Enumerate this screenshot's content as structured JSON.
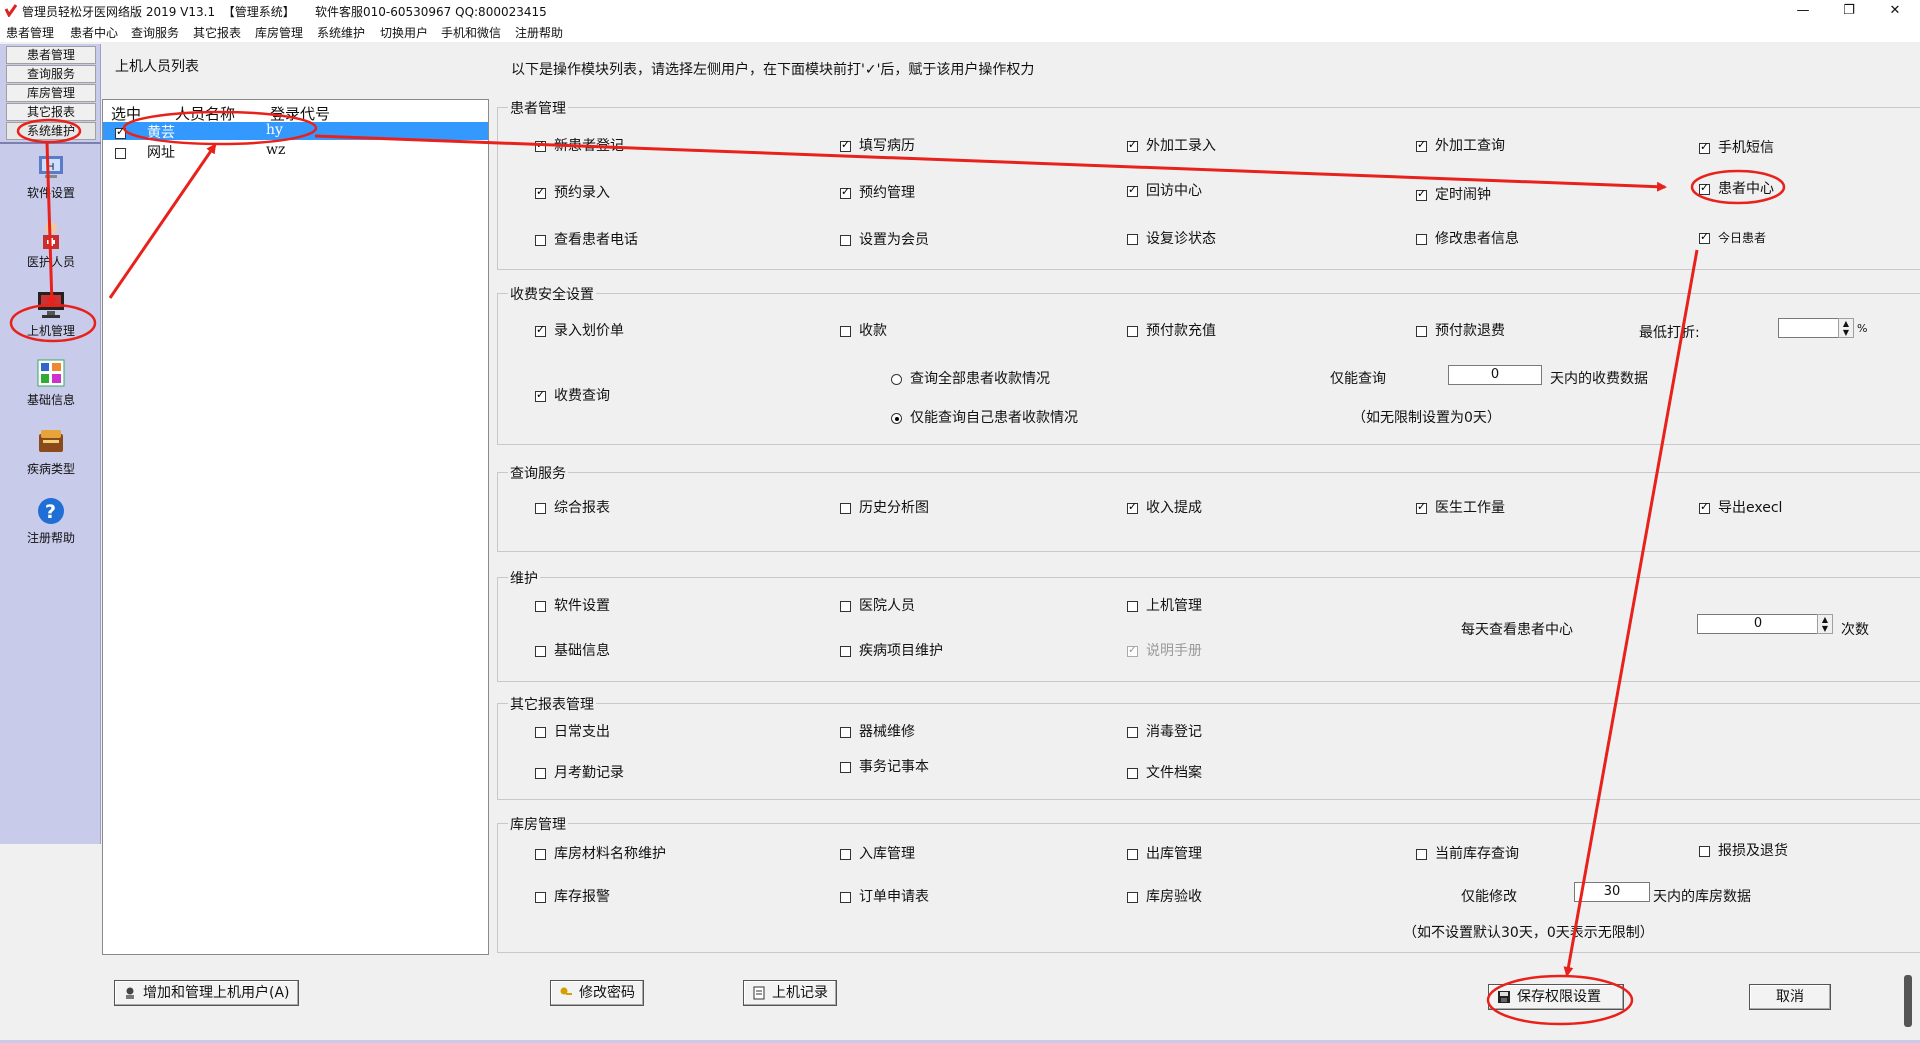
{
  "window": {
    "title": "管理员轻松牙医网络版 2019 V13.1",
    "system_tag": "【管理系统】",
    "support": "软件客服010-60530967 QQ:800023415",
    "controls": {
      "minimize": "—",
      "restore": "❐",
      "close": "✕"
    }
  },
  "menubar": [
    "患者管理",
    "患者中心",
    "查询服务",
    "其它报表",
    "库房管理",
    "系统维护",
    "切换用户",
    "手机和微信",
    "注册帮助"
  ],
  "leftnav": {
    "tabs": [
      "患者管理",
      "查询服务",
      "库房管理",
      "其它报表",
      "系统维护"
    ],
    "buttons": [
      {
        "label": "软件设置",
        "icon": "software-settings-icon"
      },
      {
        "label": "医护人员",
        "icon": "medical-staff-icon"
      },
      {
        "label": "上机管理",
        "icon": "computer-management-icon"
      },
      {
        "label": "基础信息",
        "icon": "basic-info-icon"
      },
      {
        "label": "疾病类型",
        "icon": "disease-type-icon"
      },
      {
        "label": "注册帮助",
        "icon": "help-icon"
      }
    ]
  },
  "userpanel": {
    "title": "上机人员列表",
    "headers": {
      "select": "选中",
      "name": "人员名称",
      "code": "登录代号"
    },
    "rows": [
      {
        "checked": true,
        "name": "黄芸",
        "code": "hy",
        "selected": true
      },
      {
        "checked": false,
        "name": "网址",
        "code": "wz",
        "selected": false
      }
    ]
  },
  "hint": "以下是操作模块列表，请选择左侧用户，在下面模块前打'✓'后，赋于该用户操作权力",
  "groups": {
    "patient": {
      "title": "患者管理",
      "items": [
        {
          "label": "新患者登记",
          "checked": true
        },
        {
          "label": "填写病历",
          "checked": true
        },
        {
          "label": "外加工录入",
          "checked": true
        },
        {
          "label": "外加工查询",
          "checked": true
        },
        {
          "label": "手机短信",
          "checked": true
        },
        {
          "label": "预约录入",
          "checked": true
        },
        {
          "label": "预约管理",
          "checked": true
        },
        {
          "label": "回访中心",
          "checked": true
        },
        {
          "label": "定时闹钟",
          "checked": true
        },
        {
          "label": "患者中心",
          "checked": true
        },
        {
          "label": "查看患者电话",
          "checked": false
        },
        {
          "label": "设置为会员",
          "checked": false
        },
        {
          "label": "设复诊状态",
          "checked": false
        },
        {
          "label": "修改患者信息",
          "checked": false
        },
        {
          "label": "今日患者",
          "checked": true
        }
      ]
    },
    "fee": {
      "title": "收费安全设置",
      "items": [
        {
          "label": "录入划价单",
          "checked": true
        },
        {
          "label": "收款",
          "checked": false
        },
        {
          "label": "预付款充值",
          "checked": false
        },
        {
          "label": "预付款退费",
          "checked": false
        },
        {
          "label": "收费查询",
          "checked": true
        }
      ],
      "min_discount_label": "最低打折:",
      "min_discount_value": "",
      "percent": "%",
      "radio_all": "查询全部患者收款情况",
      "radio_own": "仅能查询自己患者收款情况",
      "query_only_label": "仅能查询",
      "query_days": "0",
      "query_suffix": "天内的收费数据",
      "query_note": "（如无限制设置为0天）"
    },
    "query": {
      "title": "查询服务",
      "items": [
        {
          "label": "综合报表",
          "checked": false
        },
        {
          "label": "历史分析图",
          "checked": false
        },
        {
          "label": "收入提成",
          "checked": true
        },
        {
          "label": "医生工作量",
          "checked": true
        },
        {
          "label": "导出execl",
          "checked": true
        }
      ]
    },
    "maint": {
      "title": "维护",
      "items": [
        {
          "label": "软件设置",
          "checked": false
        },
        {
          "label": "医院人员",
          "checked": false
        },
        {
          "label": "上机管理",
          "checked": false
        },
        {
          "label": "基础信息",
          "checked": false
        },
        {
          "label": "疾病项目维护",
          "checked": false
        },
        {
          "label": "说明手册",
          "checked": true,
          "disabled": true
        }
      ],
      "daily_label": "每天查看患者中心",
      "daily_value": "0",
      "daily_unit": "次数"
    },
    "reports": {
      "title": "其它报表管理",
      "items": [
        {
          "label": "日常支出",
          "checked": false
        },
        {
          "label": "器械维修",
          "checked": false
        },
        {
          "label": "消毒登记",
          "checked": false
        },
        {
          "label": "月考勤记录",
          "checked": false
        },
        {
          "label": "事务记事本",
          "checked": false
        },
        {
          "label": "文件档案",
          "checked": false
        }
      ]
    },
    "storage": {
      "title": "库房管理",
      "items": [
        {
          "label": "库房材料名称维护",
          "checked": false
        },
        {
          "label": "入库管理",
          "checked": false
        },
        {
          "label": "出库管理",
          "checked": false
        },
        {
          "label": "当前库存查询",
          "checked": false
        },
        {
          "label": "报损及退货",
          "checked": false
        },
        {
          "label": "库存报警",
          "checked": false
        },
        {
          "label": "订单申请表",
          "checked": false
        },
        {
          "label": "库房验收",
          "checked": false
        }
      ],
      "modify_label": "仅能修改",
      "modify_days": "30",
      "modify_suffix": "天内的库房数据",
      "modify_note": "（如不设置默认30天，0天表示无限制）"
    }
  },
  "buttons": {
    "add_user": "增加和管理上机用户(A)",
    "change_pwd": "修改密码",
    "login_log": "上机记录",
    "save": "保存权限设置",
    "cancel": "取消"
  },
  "colors": {
    "annotation": "#e8211b",
    "nav_bg": "#c9cbeb",
    "selection": "#3399ff"
  }
}
